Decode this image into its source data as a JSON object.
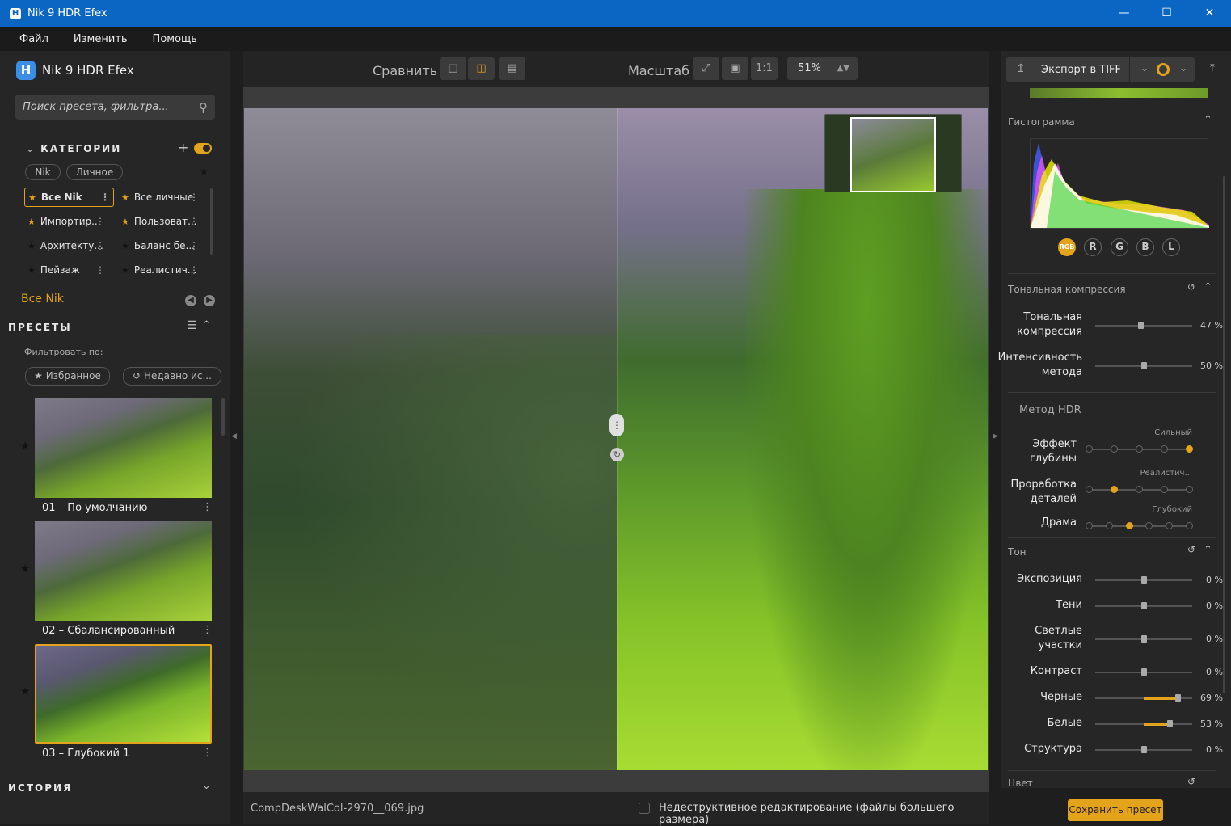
{
  "window": {
    "title": "Nik 9 HDR Efex",
    "app_icon": "H"
  },
  "menu": [
    "Файл",
    "Изменить",
    "Помощь"
  ],
  "left": {
    "brand": "Nik 9 HDR Efex",
    "search_placeholder": "Поиск пресета, фильтра...",
    "categories_title": "КАТЕГОРИИ",
    "chips": [
      "Nik",
      "Личное"
    ],
    "categories": [
      {
        "label": "Все Nik",
        "star": true,
        "selected": true
      },
      {
        "label": "Все личные",
        "star": true
      },
      {
        "label": "Импортир...",
        "star": true
      },
      {
        "label": "Пользоват...",
        "star": true
      },
      {
        "label": "Архитекту...",
        "star": false
      },
      {
        "label": "Баланс бе...",
        "star": false
      },
      {
        "label": "Пейзаж",
        "star": false
      },
      {
        "label": "Реалистич...",
        "star": false
      }
    ],
    "current_category": "Все Nik",
    "presets_title": "ПРЕСЕТЫ",
    "filter_by": "Фильтровать по:",
    "filter_favorites": "Избранное",
    "filter_recent": "Недавно ис...",
    "presets": [
      "01 – По умолчанию",
      "02 – Сбалансированный",
      "03 – Глубокий 1"
    ],
    "history_title": "ИСТОРИЯ"
  },
  "toolbar": {
    "compare": "Сравнить",
    "zoom": "Масштаб",
    "one_to_one": "1:1",
    "zoom_value": "51%"
  },
  "status": {
    "filename": "CompDeskWalCol-2970__069.jpg",
    "nondestructive": "Недеструктивное редактирование (файлы большего размера)"
  },
  "right": {
    "export": "Экспорт в TIFF",
    "histogram_title": "Гистограмма",
    "channels": [
      "RGB",
      "R",
      "G",
      "B",
      "L"
    ],
    "tonal_title": "Тональная компрессия",
    "tonal_sliders": [
      {
        "label": "Тональная компрессия",
        "value": "47 %",
        "fraction": 0.47
      },
      {
        "label": "Интенсивность метода",
        "value": "50 %",
        "fraction": 0.5
      }
    ],
    "hdr_method_title": "Метод HDR",
    "hdr_sliders": [
      {
        "label": "Эффект глубины",
        "tag": "Сильный",
        "position": 4,
        "steps": 4
      },
      {
        "label": "Проработка деталей",
        "tag": "Реалистич...",
        "position": 1,
        "steps": 4
      },
      {
        "label": "Драма",
        "tag": "Глубокий",
        "position": 2,
        "steps": 5
      }
    ],
    "tone_title": "Тон",
    "tone_sliders": [
      {
        "label": "Экспозиция",
        "value": "0 %",
        "fraction": 0.5
      },
      {
        "label": "Тени",
        "value": "0 %",
        "fraction": 0.5
      },
      {
        "label": "Светлые участки",
        "value": "0 %",
        "fraction": 0.5
      },
      {
        "label": "Контраст",
        "value": "0 %",
        "fraction": 0.5
      },
      {
        "label": "Черные",
        "value": "69 %",
        "fraction": 0.85
      },
      {
        "label": "Белые",
        "value": "53 %",
        "fraction": 0.77
      },
      {
        "label": "Структура",
        "value": "0 %",
        "fraction": 0.5
      }
    ],
    "color_title": "Цвет",
    "save_preset": "Сохранить пресет"
  },
  "colors": {
    "accent": "#e3a31a",
    "titlebar": "#0a66c2"
  }
}
